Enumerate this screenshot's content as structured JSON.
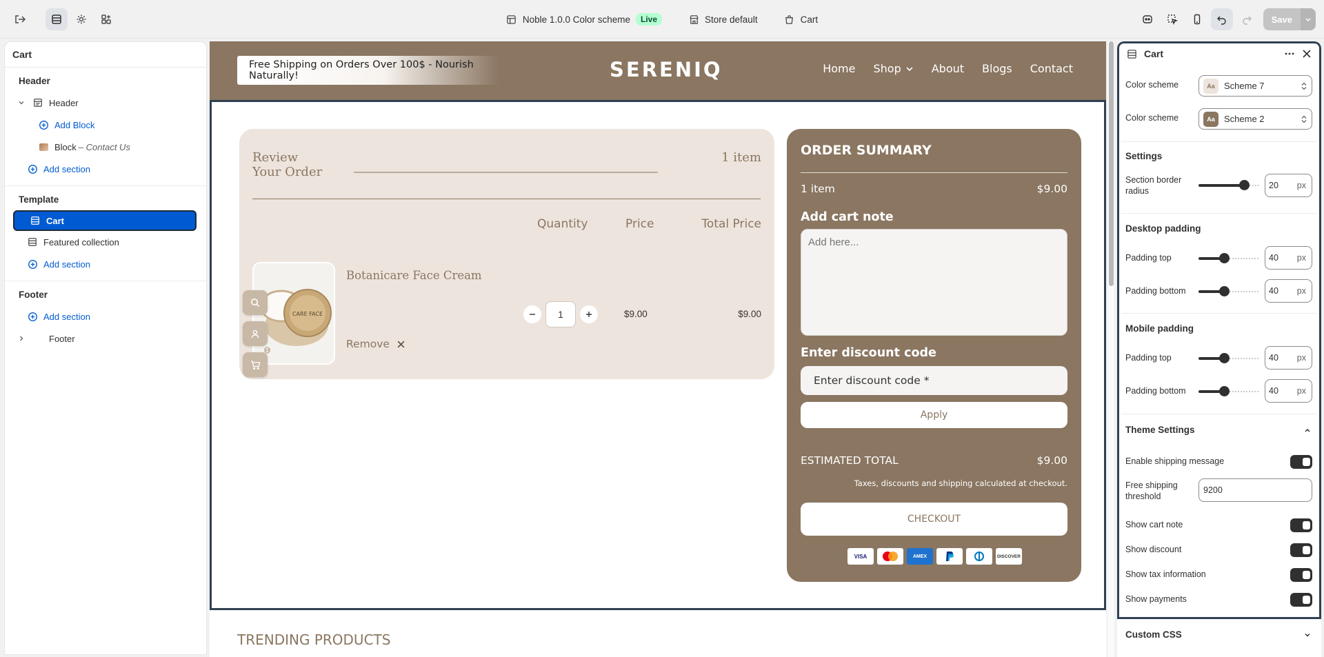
{
  "topbar": {
    "theme_name": "Noble 1.0.0 Color scheme",
    "live_badge": "Live",
    "store": "Store default",
    "page": "Cart",
    "save_label": "Save"
  },
  "sidebar": {
    "title": "Cart",
    "header_group": "Header",
    "header_item": "Header",
    "add_block": "Add Block",
    "block_label": "Block",
    "block_suffix": "– Contact Us",
    "add_section": "Add section",
    "template_group": "Template",
    "template_items": [
      "Cart",
      "Featured collection"
    ],
    "footer_group": "Footer",
    "footer_item": "Footer"
  },
  "store": {
    "shipping_message": "Free Shipping on Orders Over 100$ - Nourish Naturally!",
    "logo": "SERENIQ",
    "nav": [
      "Home",
      "Shop",
      "About",
      "Blogs",
      "Contact"
    ],
    "trending": "TRENDING PRODUCTS"
  },
  "cart": {
    "review_title": "Review Your Order",
    "item_count": "1 item",
    "col_quantity": "Quantity",
    "col_price": "Price",
    "col_total": "Total Price",
    "product_name": "Botanicare Face Cream",
    "remove_label": "Remove",
    "quantity": "1",
    "price": "$9.00",
    "total": "$9.00",
    "cart_badge": "1"
  },
  "summary": {
    "title": "ORDER SUMMARY",
    "items_label": "1 item",
    "items_price": "$9.00",
    "note_heading": "Add cart note",
    "note_placeholder": "Add here...",
    "discount_heading": "Enter discount code",
    "discount_placeholder": "Enter discount code *",
    "apply_label": "Apply",
    "estimated_label": "ESTIMATED TOTAL",
    "estimated_value": "$9.00",
    "tax_note": "Taxes, discounts and shipping calculated at checkout.",
    "checkout_label": "CHECKOUT",
    "payments": [
      "VISA",
      "Mastercard",
      "AMEX",
      "PayPal",
      "Diners",
      "DISCOVER"
    ]
  },
  "panel": {
    "title": "Cart",
    "color_scheme_label": "Color scheme",
    "scheme_1": "Scheme 7",
    "scheme_2": "Scheme 2",
    "swatch_text": "Aa",
    "settings_heading": "Settings",
    "border_radius_label": "Section border radius",
    "border_radius_value": "20",
    "unit": "px",
    "desktop_heading": "Desktop padding",
    "padding_top_label": "Padding top",
    "padding_bottom_label": "Padding bottom",
    "desktop_top": "40",
    "desktop_bottom": "40",
    "mobile_heading": "Mobile padding",
    "mobile_top": "40",
    "mobile_bottom": "40",
    "theme_settings_heading": "Theme Settings",
    "enable_shipping_label": "Enable shipping message",
    "threshold_label": "Free shipping threshold",
    "threshold_value": "9200",
    "show_cart_note": "Show cart note",
    "show_discount": "Show discount",
    "show_tax": "Show tax information",
    "show_payments": "Show payments",
    "custom_css": "Custom CSS"
  },
  "colors": {
    "accent": "#005bd3",
    "brand_brown": "#8a7661",
    "cart_bg": "#ede4dd",
    "live_badge": "#b4fed2"
  }
}
